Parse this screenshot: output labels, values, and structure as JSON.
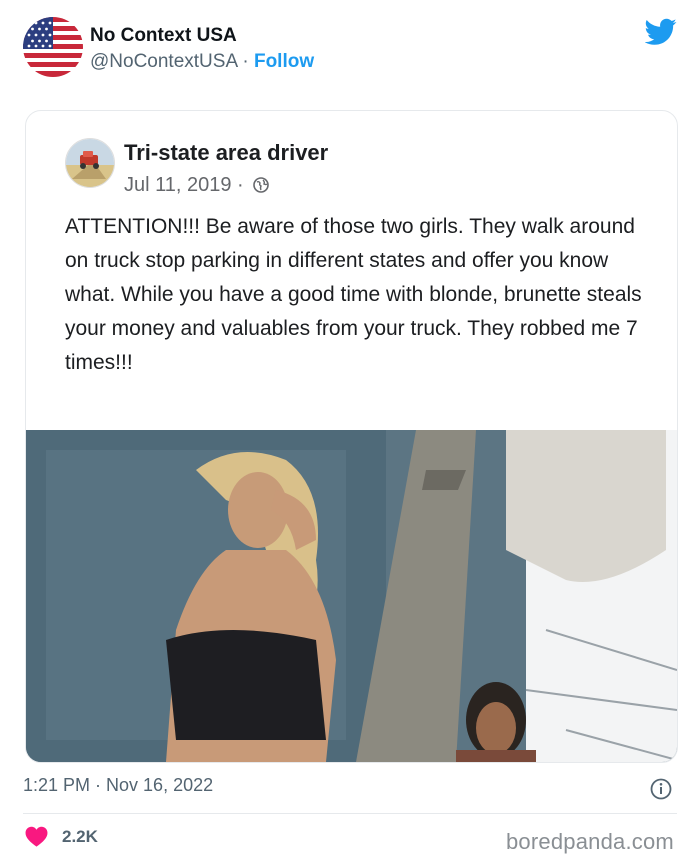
{
  "tweet": {
    "author_name": "No Context USA",
    "author_handle": "@NoContextUSA",
    "separator": " · ",
    "follow_label": "Follow",
    "timestamp": "1:21 PM · Nov 16, 2022",
    "like_count": "2.2K",
    "icons": [
      "us-flag-avatar",
      "twitter-bird-icon",
      "info-icon",
      "heart-icon"
    ]
  },
  "embedded_post": {
    "author": "Tri-state area driver",
    "date": "Jul 11, 2019 ·",
    "text": "ATTENTION!!! Be aware of those two girls. They walk around on truck stop parking in different states and offer you know what. While you have a good time with blonde, brunette steals your money and valuables from your truck. They robbed me 7 times!!!"
  },
  "watermark": "boredpanda.com",
  "colors": {
    "accent": "#1d9bf0",
    "heart": "#f91880",
    "muted": "#536471"
  }
}
